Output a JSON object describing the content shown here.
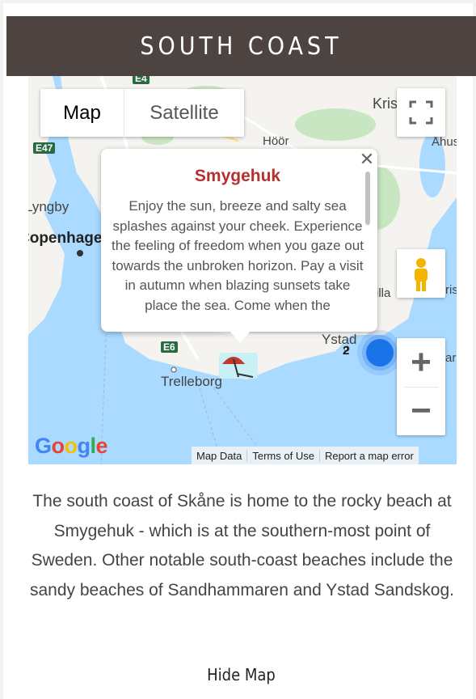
{
  "header": {
    "title": "SOUTH COAST"
  },
  "map": {
    "type_controls": {
      "map_label": "Map",
      "satellite_label": "Satellite",
      "selected": "Map"
    },
    "labels": {
      "hoor": "Höör",
      "ahus": "Åhus",
      "lyngby": "Lyngby",
      "copenhagen": "Copenhagen",
      "trelleborg": "Trelleborg",
      "ystad": "Ystad",
      "kris": "Kris",
      "illa": "illa",
      "ris": "ris",
      "ar": "ar",
      "cluster_count": "2"
    },
    "road_signs": {
      "e47": "E47",
      "e6": "E6",
      "e4": "E4"
    },
    "popup": {
      "title": "Smygehuk",
      "body": "Enjoy the sun, breeze and salty sea splashes against your cheek. Experience the feeling of freedom when you gaze out towards the unbroken horizon. Pay a visit in autumn when blazing sunsets take place the sea. Come when the",
      "close_icon": "close-icon"
    },
    "zoom": {
      "plus": "+",
      "minus": "−"
    },
    "attribution": {
      "map_data": "Map Data",
      "terms": "Terms of Use",
      "report": "Report a map error"
    },
    "logo_text": "Google",
    "colors": {
      "water": "#aadaff",
      "land": "#f5f3ef",
      "park": "#c8e6c1",
      "road": "#ffffff",
      "marker": "#1a73e8"
    }
  },
  "description": "The south coast of Skåne is home to the rocky beach at Smygehuk - which is at the southern-most point of Sweden. Other notable south-coast beaches include the sandy beaches of Sandhammaren and Ystad Sandskog.",
  "hide_map_label": "Hide Map"
}
